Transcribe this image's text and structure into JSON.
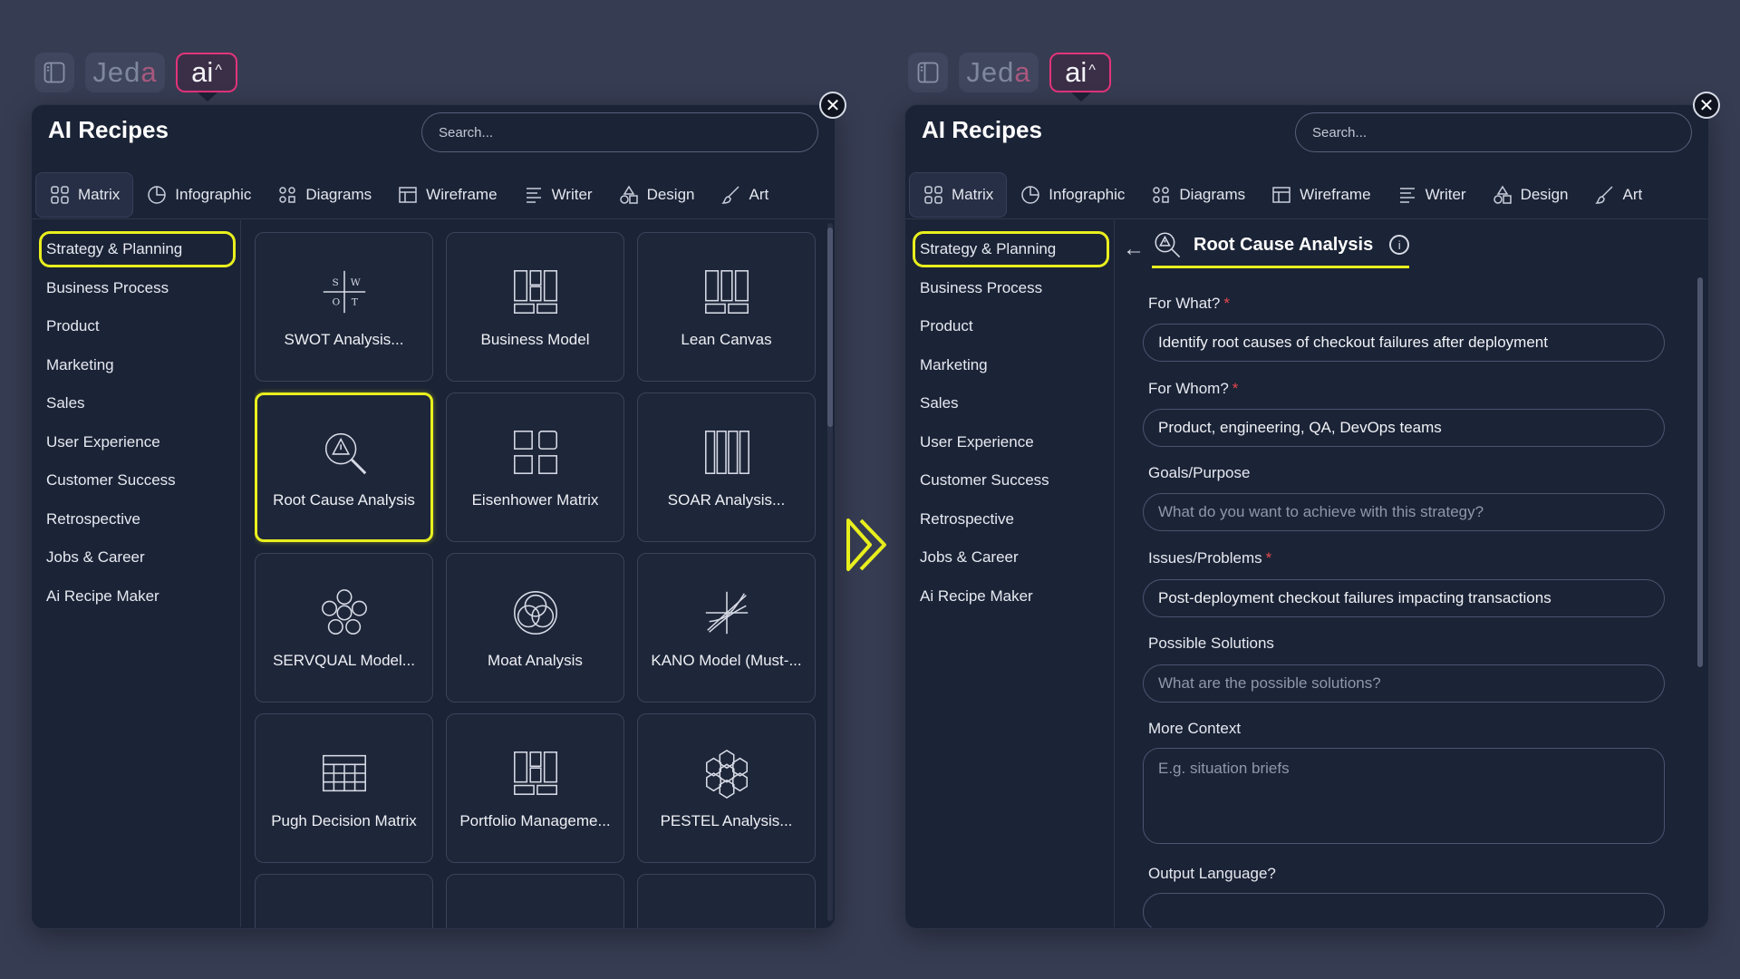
{
  "topbar": {
    "brand_main": "Jed",
    "brand_accent": "a",
    "ai_label": "ai",
    "ai_caret": "^"
  },
  "panel": {
    "title": "AI Recipes",
    "search_placeholder": "Search...",
    "close_glyph": "✕",
    "tabs": [
      {
        "label": "Matrix",
        "icon": "grid-icon"
      },
      {
        "label": "Infographic",
        "icon": "pie-chart-icon"
      },
      {
        "label": "Diagrams",
        "icon": "diagram-icon"
      },
      {
        "label": "Wireframe",
        "icon": "wireframe-icon"
      },
      {
        "label": "Writer",
        "icon": "text-lines-icon"
      },
      {
        "label": "Design",
        "icon": "shapes-icon"
      },
      {
        "label": "Art",
        "icon": "brush-icon"
      }
    ],
    "categories": [
      "Strategy & Planning",
      "Business Process",
      "Product",
      "Marketing",
      "Sales",
      "User Experience",
      "Customer Success",
      "Retrospective",
      "Jobs & Career",
      "Ai Recipe Maker"
    ]
  },
  "cards": [
    {
      "label": "SWOT Analysis...",
      "icon": "swot-icon"
    },
    {
      "label": "Business Model",
      "icon": "business-model-icon"
    },
    {
      "label": "Lean Canvas",
      "icon": "lean-canvas-icon"
    },
    {
      "label": "Root Cause Analysis",
      "icon": "magnifier-warning-icon"
    },
    {
      "label": "Eisenhower Matrix",
      "icon": "quadrant-icon"
    },
    {
      "label": "SOAR Analysis...",
      "icon": "columns-icon"
    },
    {
      "label": "SERVQUAL Model...",
      "icon": "flower-icon"
    },
    {
      "label": "Moat Analysis",
      "icon": "venn-icon"
    },
    {
      "label": "KANO Model (Must-...",
      "icon": "kano-icon"
    },
    {
      "label": "Pugh Decision Matrix",
      "icon": "table-icon"
    },
    {
      "label": "Portfolio Manageme...",
      "icon": "portfolio-icon"
    },
    {
      "label": "PESTEL Analysis...",
      "icon": "hexagon-cluster-icon"
    }
  ],
  "form": {
    "recipe_title": "Root Cause Analysis",
    "back_glyph": "←",
    "info_glyph": "i",
    "fields": [
      {
        "label": "For What?",
        "required": "*",
        "value": "Identify root causes of checkout failures after deployment"
      },
      {
        "label": "For Whom?",
        "required": "*",
        "value": "Product, engineering, QA, DevOps teams"
      },
      {
        "label": "Goals/Purpose",
        "required": "",
        "placeholder": "What do you want to achieve with this strategy?"
      },
      {
        "label": "Issues/Problems",
        "required": "*",
        "value": "Post-deployment checkout failures impacting transactions"
      },
      {
        "label": "Possible Solutions",
        "required": "",
        "placeholder": "What are the possible solutions?"
      },
      {
        "label": "More Context",
        "required": "",
        "placeholder": "E.g. situation briefs"
      },
      {
        "label": "Output Language?",
        "required": ""
      }
    ]
  },
  "colors": {
    "highlight": "#e9ef1d",
    "ai_border": "#e2347a",
    "required": "#e5484d"
  }
}
